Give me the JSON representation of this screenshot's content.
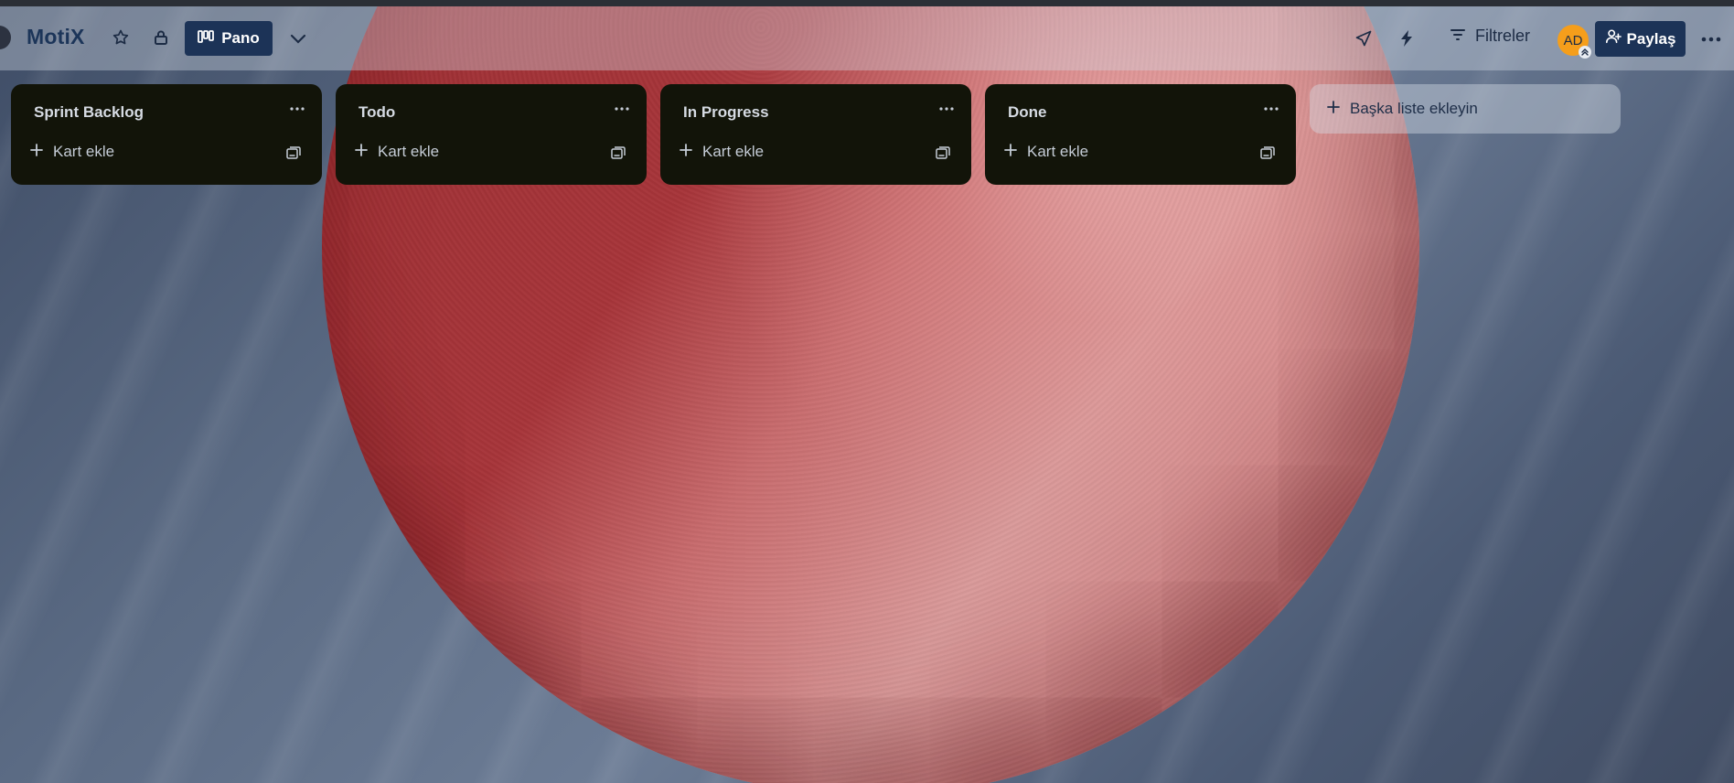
{
  "header": {
    "board_title": "MotiX",
    "view_button_label": "Pano",
    "filters_label": "Filtreler",
    "avatar_initials": "AD",
    "share_label": "Paylaş"
  },
  "lists": [
    {
      "title": "Sprint Backlog",
      "add_card_label": "Kart ekle"
    },
    {
      "title": "Todo",
      "add_card_label": "Kart ekle"
    },
    {
      "title": "In Progress",
      "add_card_label": "Kart ekle"
    },
    {
      "title": "Done",
      "add_card_label": "Kart ekle"
    }
  ],
  "add_list_label": "Başka liste ekleyin",
  "icons": {
    "star": "star-icon",
    "lock": "lock-icon",
    "board": "board-view-icon",
    "chevron": "chevron-down-icon",
    "rocket": "rocket-icon",
    "automation": "lightning-icon",
    "filter": "filter-icon",
    "share": "add-person-icon",
    "more": "more-icon",
    "plus": "plus-icon",
    "template": "card-template-icon"
  },
  "colors": {
    "header_title": "#1c3559",
    "primary_button": "#1c3357",
    "list_background": "#121409",
    "avatar": "#f59e1b"
  }
}
